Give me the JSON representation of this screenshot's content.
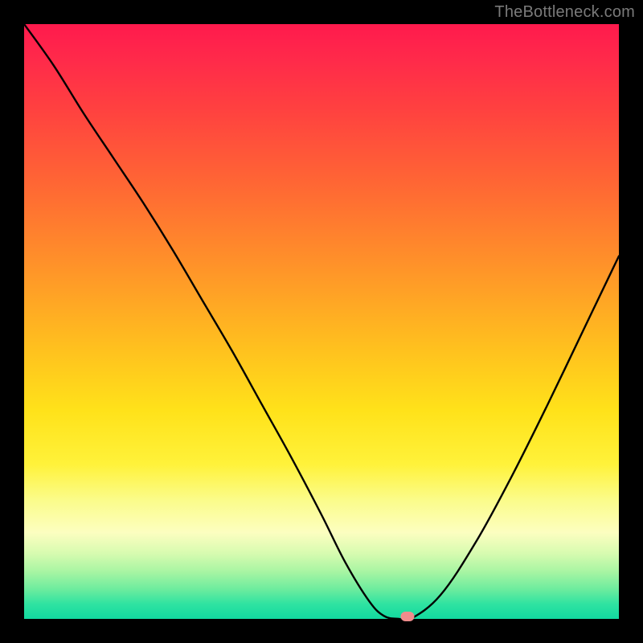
{
  "watermark": "TheBottleneck.com",
  "colors": {
    "frame_bg": "#000000",
    "curve_stroke": "#000000",
    "marker_fill": "#ef8c8c",
    "watermark_text": "#7a7a7a"
  },
  "chart_data": {
    "type": "line",
    "title": "",
    "xlabel": "",
    "ylabel": "",
    "xlim": [
      0,
      100
    ],
    "ylim": [
      0,
      100
    ],
    "grid": false,
    "legend": "none",
    "background": {
      "type": "vertical-gradient",
      "stops": [
        {
          "pos": 0,
          "color": "#ff1a4d"
        },
        {
          "pos": 14,
          "color": "#ff4040"
        },
        {
          "pos": 28,
          "color": "#ff6a33"
        },
        {
          "pos": 42,
          "color": "#ff9728"
        },
        {
          "pos": 55,
          "color": "#ffc21e"
        },
        {
          "pos": 65,
          "color": "#ffe21a"
        },
        {
          "pos": 74,
          "color": "#fff23a"
        },
        {
          "pos": 85.5,
          "color": "#fcfec0"
        },
        {
          "pos": 92,
          "color": "#a9f5a3"
        },
        {
          "pos": 100,
          "color": "#12d9a0"
        }
      ]
    },
    "series": [
      {
        "name": "bottleneck-curve",
        "x": [
          0.0,
          5.0,
          10.0,
          15.0,
          20.0,
          25.0,
          30.0,
          35.0,
          40.0,
          45.0,
          50.0,
          54.0,
          58.0,
          60.5,
          63.0,
          65.0,
          70.0,
          76.0,
          82.0,
          88.0,
          94.0,
          100.0
        ],
        "y": [
          100.0,
          93.0,
          85.0,
          77.5,
          70.0,
          62.0,
          53.5,
          45.0,
          36.0,
          27.0,
          17.5,
          9.5,
          3.0,
          0.5,
          0.0,
          0.0,
          4.0,
          13.0,
          24.0,
          36.0,
          48.5,
          61.0
        ]
      }
    ],
    "marker": {
      "label": "optimal-point",
      "x": 64.5,
      "y": 0.4,
      "color": "#ef8c8c"
    }
  }
}
